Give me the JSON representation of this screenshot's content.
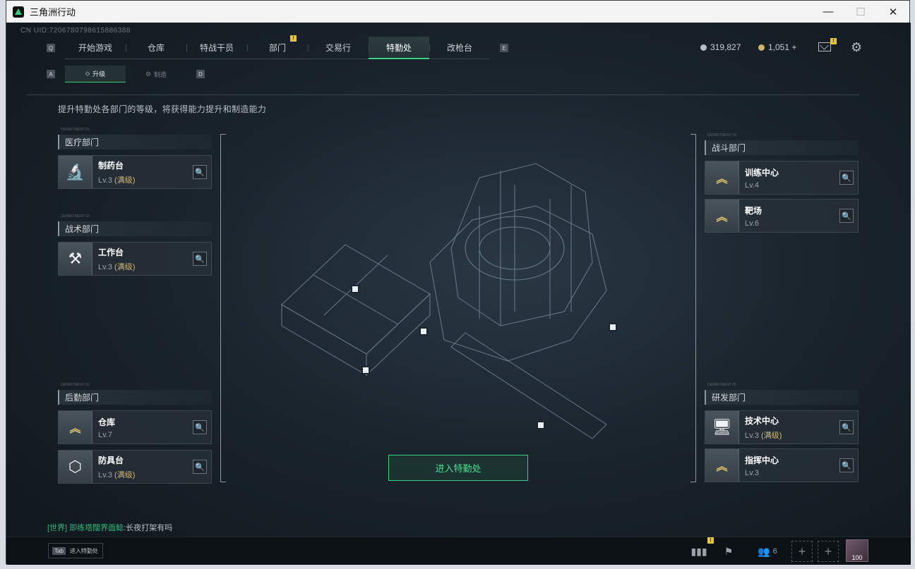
{
  "window": {
    "title": "三角洲行动",
    "min": "—",
    "max": "☐",
    "close": "✕"
  },
  "uid": "CN UID:7206780798615886388",
  "nav": {
    "key_left": "Q",
    "key_right": "E",
    "tabs": [
      "开始游戏",
      "仓库",
      "特战干员",
      "部门",
      "交易行",
      "特勤处",
      "改枪台"
    ],
    "active": "特勤处",
    "badge": "!"
  },
  "currency": {
    "silver": "319,827",
    "gold": "1,051 +"
  },
  "mail_badge": "!",
  "subnav": {
    "key_left": "A",
    "key_right": "D",
    "upgrade": "升级",
    "craft": "制造"
  },
  "description": "提升特勤处各部门的等级，将获得能力提升和制造能力",
  "departments": {
    "medical": {
      "title": "医疗部门",
      "tag": "DEPARTMENT 01",
      "items": [
        {
          "name": "制药台",
          "level": "Lv.3",
          "max": "(满级)",
          "icon": "microscope-icon"
        }
      ]
    },
    "tactical": {
      "title": "战术部门",
      "tag": "DEPARTMENT 02",
      "items": [
        {
          "name": "工作台",
          "level": "Lv.3",
          "max": "(满级)",
          "icon": "tools-icon"
        }
      ]
    },
    "logistics": {
      "title": "后勤部门",
      "tag": "DEPARTMENT 03",
      "items": [
        {
          "name": "仓库",
          "level": "Lv.7",
          "max": "",
          "icon": "chevron-rank-icon"
        },
        {
          "name": "防具台",
          "level": "Lv.3",
          "max": "(满级)",
          "icon": "cubes-icon"
        }
      ]
    },
    "combat": {
      "title": "战斗部门",
      "tag": "DEPARTMENT 04",
      "items": [
        {
          "name": "训练中心",
          "level": "Lv.4",
          "max": "",
          "icon": "training-rank-icon"
        },
        {
          "name": "靶场",
          "level": "Lv.6",
          "max": "",
          "icon": "range-rank-icon"
        }
      ]
    },
    "research": {
      "title": "研发部门",
      "tag": "DEPARTMENT 05",
      "items": [
        {
          "name": "技术中心",
          "level": "Lv.3",
          "max": "(满级)",
          "icon": "monitor-icon"
        },
        {
          "name": "指挥中心",
          "level": "Lv.3",
          "max": "",
          "icon": "command-rank-icon"
        }
      ]
    }
  },
  "enter_button": "进入特勤处",
  "chat": {
    "channel": "[世界]",
    "name": "即练塔闊界面鲶",
    "message": ":长夜打架有吗"
  },
  "bottom": {
    "tab_key": "Tab",
    "tab_label": "进入特勤处",
    "friends_count": "6",
    "avatar_label": "100"
  }
}
